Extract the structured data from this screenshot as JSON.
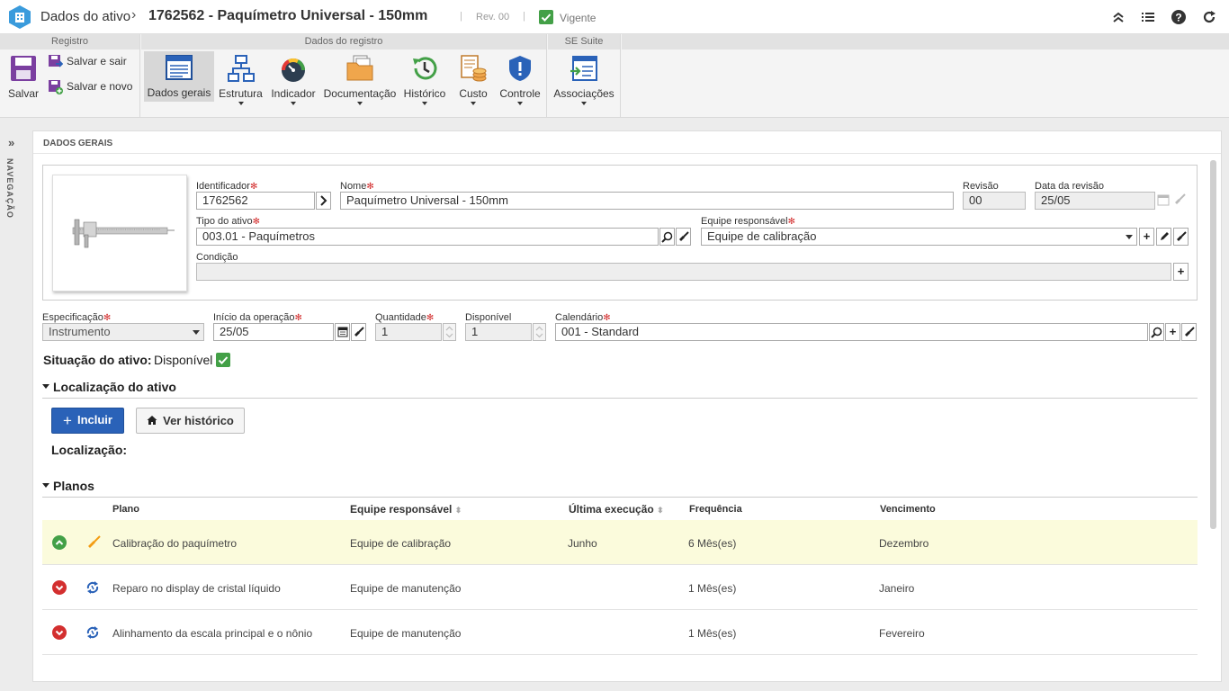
{
  "header": {
    "title": "Dados do ativo",
    "record": "1762562 - Paquímetro Universal - 150mm",
    "sep": "|",
    "revision": "Rev. 00",
    "status": "Vigente"
  },
  "ribbon": {
    "groups": [
      "Registro",
      "Dados do registro",
      "SE Suite"
    ],
    "save": "Salvar",
    "save_exit": "Salvar e sair",
    "save_new": "Salvar e novo",
    "general": "Dados gerais",
    "structure": "Estrutura",
    "indicator": "Indicador",
    "documentation": "Documentação",
    "history": "Histórico",
    "cost": "Custo",
    "control": "Controle",
    "associations": "Associações"
  },
  "nav": {
    "label": "NAVEGAÇÃO",
    "toggle": "»"
  },
  "panel": {
    "title": "DADOS GERAIS"
  },
  "form": {
    "identifier_label": "Identificador",
    "identifier": "1762562",
    "name_label": "Nome",
    "name": "Paquímetro Universal - 150mm",
    "revision_label": "Revisão",
    "revision": "00",
    "rev_date_label": "Data da revisão",
    "rev_date": "25/05",
    "type_label": "Tipo do ativo",
    "type": "003.01 - Paquímetros",
    "team_label": "Equipe responsável",
    "team": "Equipe de calibração",
    "condition_label": "Condição",
    "condition": "",
    "spec_label": "Especificação",
    "spec": "Instrumento",
    "start_label": "Início da operação",
    "start": "25/05",
    "qty_label": "Quantidade",
    "qty": "1",
    "avail_label": "Disponível",
    "avail": "1",
    "calendar_label": "Calendário",
    "calendar": "001 - Standard",
    "req_mark": "✻"
  },
  "situation": {
    "label": "Situação do ativo:",
    "value": "Disponível"
  },
  "location": {
    "title": "Localização do ativo",
    "add": "Incluir",
    "history": "Ver histórico",
    "label": "Localização:"
  },
  "plans": {
    "title": "Planos",
    "columns": [
      "Plano",
      "Equipe responsável",
      "Última execução",
      "Frequência",
      "Vencimento"
    ],
    "rows": [
      {
        "plan": "Calibração do paquímetro",
        "team": "Equipe de calibração",
        "last": "Junho",
        "freq": "6 Mês(es)",
        "due": "Dezembro",
        "status": "ok"
      },
      {
        "plan": "Reparo no display de cristal líquido",
        "team": "Equipe de manutenção",
        "last": "",
        "freq": "1 Mês(es)",
        "due": "Janeiro",
        "status": "late"
      },
      {
        "plan": "Alinhamento da escala principal e o nônio",
        "team": "Equipe de manutenção",
        "last": "",
        "freq": "1 Mês(es)",
        "due": "Fevereiro",
        "status": "late"
      }
    ]
  },
  "colors": {
    "accent": "#2a62b8",
    "ok": "#43a047",
    "late": "#d32f2f",
    "highlight": "#fbfbdc"
  }
}
